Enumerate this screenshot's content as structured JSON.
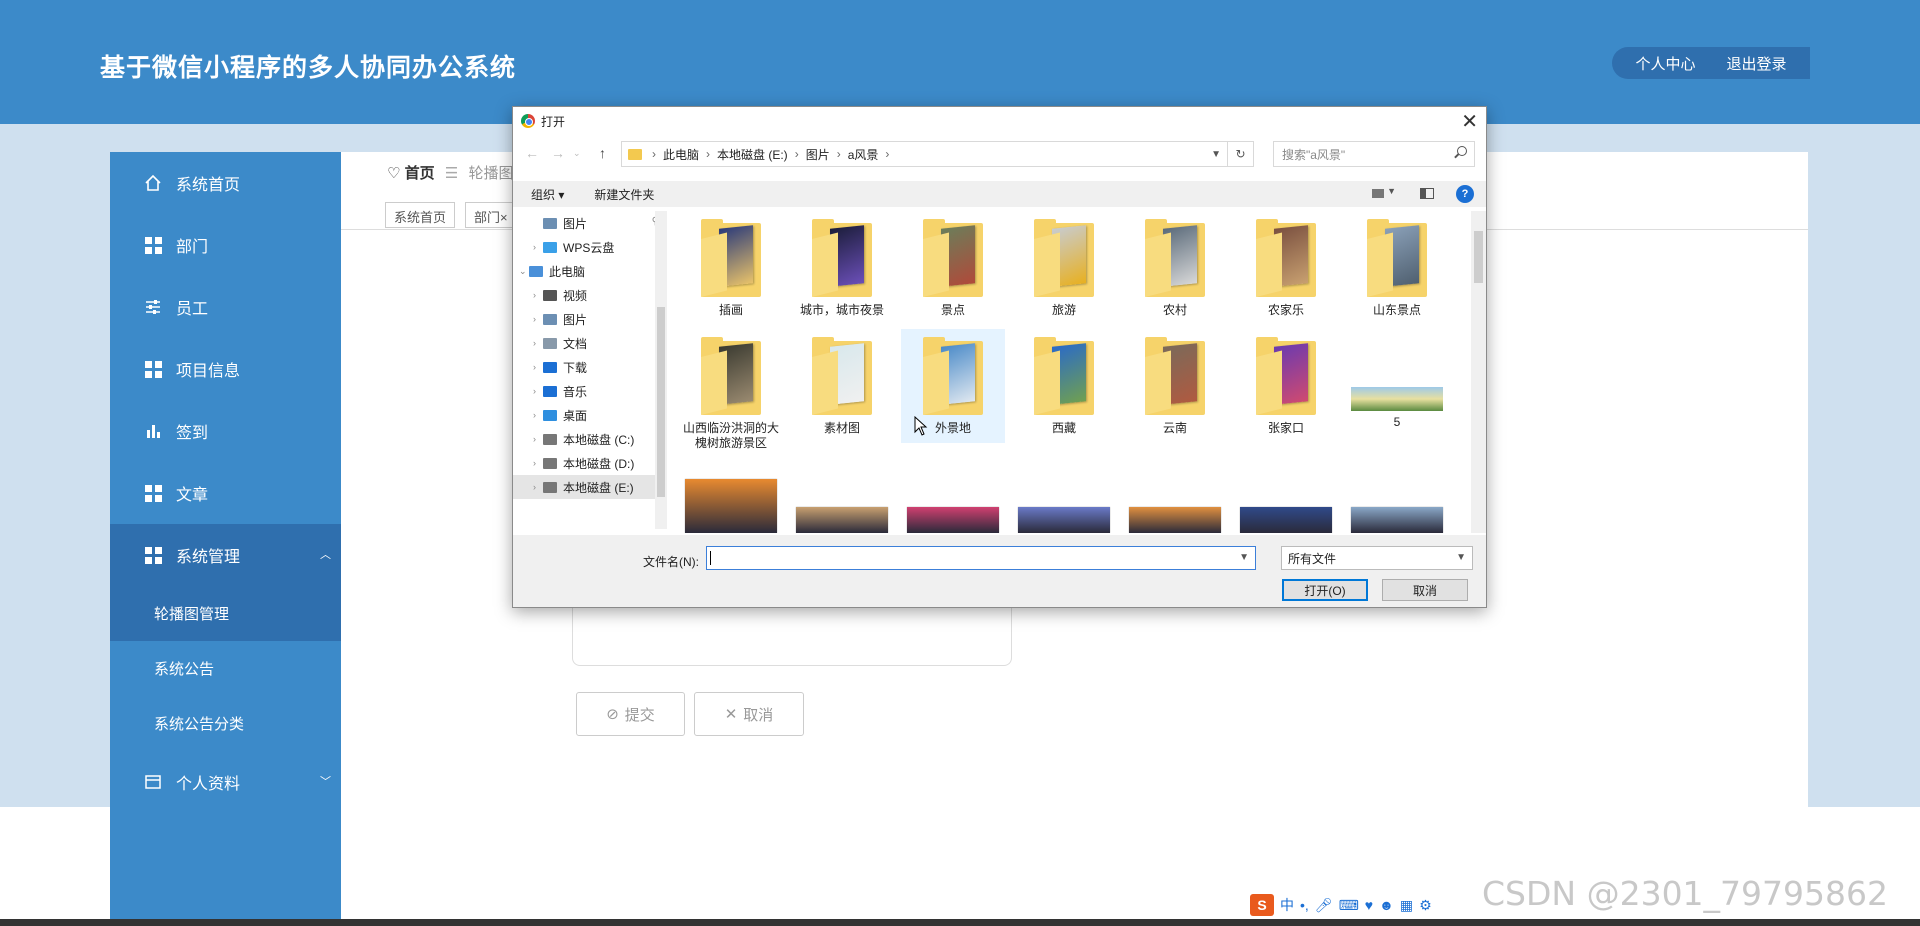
{
  "header": {
    "title": "基于微信小程序的多人协同办公系统",
    "profile_link": "个人中心",
    "logout_link": "退出登录"
  },
  "sidebar": {
    "items": [
      {
        "label": "系统首页",
        "icon": "home-icon"
      },
      {
        "label": "部门",
        "icon": "grid-icon"
      },
      {
        "label": "员工",
        "icon": "sliders-icon"
      },
      {
        "label": "项目信息",
        "icon": "grid-icon"
      },
      {
        "label": "签到",
        "icon": "bar-chart-icon"
      },
      {
        "label": "文章",
        "icon": "grid-icon"
      },
      {
        "label": "系统管理",
        "icon": "grid-icon"
      }
    ],
    "sub_items": [
      "轮播图管理",
      "系统公告",
      "系统公告分类"
    ],
    "profile": {
      "label": "个人资料",
      "icon": "card-icon"
    }
  },
  "main": {
    "breadcrumb_home": "首页",
    "breadcrumb_current": "轮播图",
    "tabs": [
      "系统首页",
      "部门×"
    ],
    "submit_label": "提交",
    "cancel_label": "取消"
  },
  "dialog": {
    "title": "打开",
    "path": [
      "此电脑",
      "本地磁盘 (E:)",
      "图片",
      "a风景"
    ],
    "search_placeholder": "搜索\"a风景\"",
    "toolbar": {
      "organize": "组织 ▾",
      "new_folder": "新建文件夹",
      "help": "?"
    },
    "tree": [
      {
        "label": "图片",
        "pinned": true,
        "icon_color": "#6c8fb3"
      },
      {
        "label": "WPS云盘",
        "icon_color": "#3aa0e8"
      },
      {
        "label": "此电脑",
        "icon_color": "#4a90d9"
      },
      {
        "label": "视频",
        "icon_color": "#555555"
      },
      {
        "label": "图片",
        "icon_color": "#6c8fb3"
      },
      {
        "label": "文档",
        "icon_color": "#8899aa"
      },
      {
        "label": "下载",
        "icon_color": "#1b6fd4"
      },
      {
        "label": "音乐",
        "icon_color": "#1b6fd4"
      },
      {
        "label": "桌面",
        "icon_color": "#2f8fdf"
      },
      {
        "label": "本地磁盘 (C:)",
        "icon_color": "#777777"
      },
      {
        "label": "本地磁盘 (D:)",
        "icon_color": "#777777"
      },
      {
        "label": "本地磁盘 (E:)",
        "icon_color": "#777777",
        "selected": true
      }
    ],
    "folders_row1": [
      {
        "name": "插画",
        "colors": [
          "#2a3a7a",
          "#e8c26a"
        ]
      },
      {
        "name": "城市，城市夜景",
        "colors": [
          "#1b1d3a",
          "#6b4fb8"
        ]
      },
      {
        "name": "景点",
        "colors": [
          "#6b7e5a",
          "#b04a3a"
        ]
      },
      {
        "name": "旅游",
        "colors": [
          "#c8ccd0",
          "#e8b020"
        ]
      },
      {
        "name": "农村",
        "colors": [
          "#5a6a7a",
          "#d8d8d8"
        ]
      },
      {
        "name": "农家乐",
        "colors": [
          "#7a5040",
          "#c8a070"
        ]
      },
      {
        "name": "山东景点",
        "colors": [
          "#8aa0b8",
          "#506070"
        ]
      }
    ],
    "folders_row2": [
      {
        "name": "山西临汾洪洞的大槐树旅游景区",
        "colors": [
          "#3a3a30",
          "#9a8a70"
        ]
      },
      {
        "name": "素材图",
        "colors": [
          "#d8e8ec",
          "#f0f0f0"
        ]
      },
      {
        "name": "外景地",
        "colors": [
          "#4a8ac8",
          "#e0e8f0"
        ],
        "selected": true
      },
      {
        "name": "西藏",
        "colors": [
          "#2a6ac8",
          "#70a050"
        ]
      },
      {
        "name": "云南",
        "colors": [
          "#7a6a5a",
          "#b05a40"
        ]
      },
      {
        "name": "张家口",
        "colors": [
          "#6a3ab0",
          "#d04a70"
        ]
      }
    ],
    "image_file": {
      "name": "5"
    },
    "row3_thumb_colors": [
      "#e88a30",
      "#c8a070",
      "#d04070",
      "#6a7ac8",
      "#e09040",
      "#304a8a",
      "#8aa8c8"
    ],
    "filename_label": "文件名(N):",
    "filename_value": "",
    "filetype": "所有文件",
    "open_button": "打开(O)",
    "cancel_button": "取消"
  },
  "ime": {
    "logo": "S",
    "mode": "中",
    "punct": "•,",
    "icons": [
      "mic-icon",
      "keyboard-icon",
      "skin-icon",
      "robot-icon",
      "apps-icon",
      "settings-icon"
    ]
  },
  "watermark": "CSDN @2301_79795862"
}
